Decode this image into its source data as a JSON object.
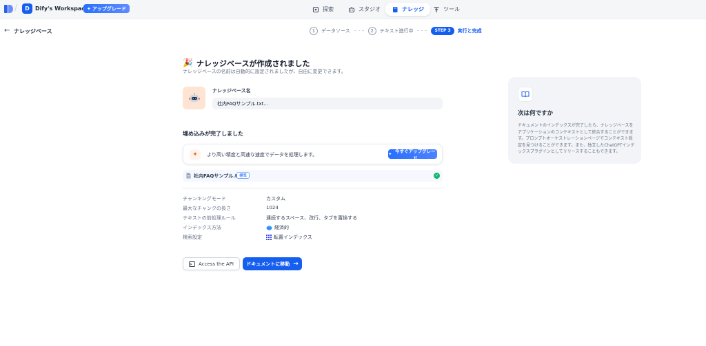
{
  "header": {
    "workspace_initial": "D",
    "workspace_name": "Dify's Workspace",
    "upgrade_label": "アップグレード",
    "nav": [
      {
        "label": "探索",
        "icon": "explore-icon"
      },
      {
        "label": "スタジオ",
        "icon": "robot-icon"
      },
      {
        "label": "ナレッジ",
        "icon": "book-icon"
      },
      {
        "label": "ツール",
        "icon": "tools-icon"
      }
    ]
  },
  "subheader": {
    "title": "ナレッジベース",
    "steps": [
      {
        "num": "1",
        "label": "データソース"
      },
      {
        "num": "2",
        "label": "テキスト進行中"
      },
      {
        "num": "STEP 3",
        "label": "実行と完成"
      }
    ]
  },
  "main": {
    "title": "ナレッジベースが作成されました",
    "subtitle": "ナレッジベースの名前は自動的に設定されましたが、自由に変更できます。",
    "kb_name_label": "ナレッジベース名",
    "kb_name_value": "社内FAQサンプル.txt...",
    "embed_title": "埋め込みが完了しました",
    "upgrade_card_text": "より高い精度と高速な速度でデータを処理します。",
    "upgrade_now_label": "今すぐアップグレード",
    "file_name": "社内FAQサンプル.txt",
    "file_badge": "標準",
    "info": [
      {
        "label": "チャンキングモード",
        "value": "カスタム",
        "icon": ""
      },
      {
        "label": "最大なチャンクの長さ",
        "value": "1024",
        "icon": ""
      },
      {
        "label": "テキストの前処理ルール",
        "value": "連続するスペース、改行、タブを置換する",
        "icon": ""
      },
      {
        "label": "インデックス方法",
        "value": "経済的",
        "icon": "economy-icon"
      },
      {
        "label": "検索設定",
        "value": "転置インデックス",
        "icon": "inverted-index-icon"
      }
    ],
    "api_button_label": "Access the API",
    "doc_button_label": "ドキュメントに移動"
  },
  "side_panel": {
    "title": "次は何ですか",
    "text": "ドキュメントのインデックスが完了したら、ナレッジベースをアプリケーションのコンテキストとして統合することができます。プロンプトオーケストレーションページでコンテキスト設定を見つけることができます。また、独立したChatGPTインデックスプラグインとしてリリースすることもできます。"
  },
  "colors": {
    "primary": "#155eef",
    "success": "#12b76a",
    "accent_orange": "#ef6820"
  }
}
